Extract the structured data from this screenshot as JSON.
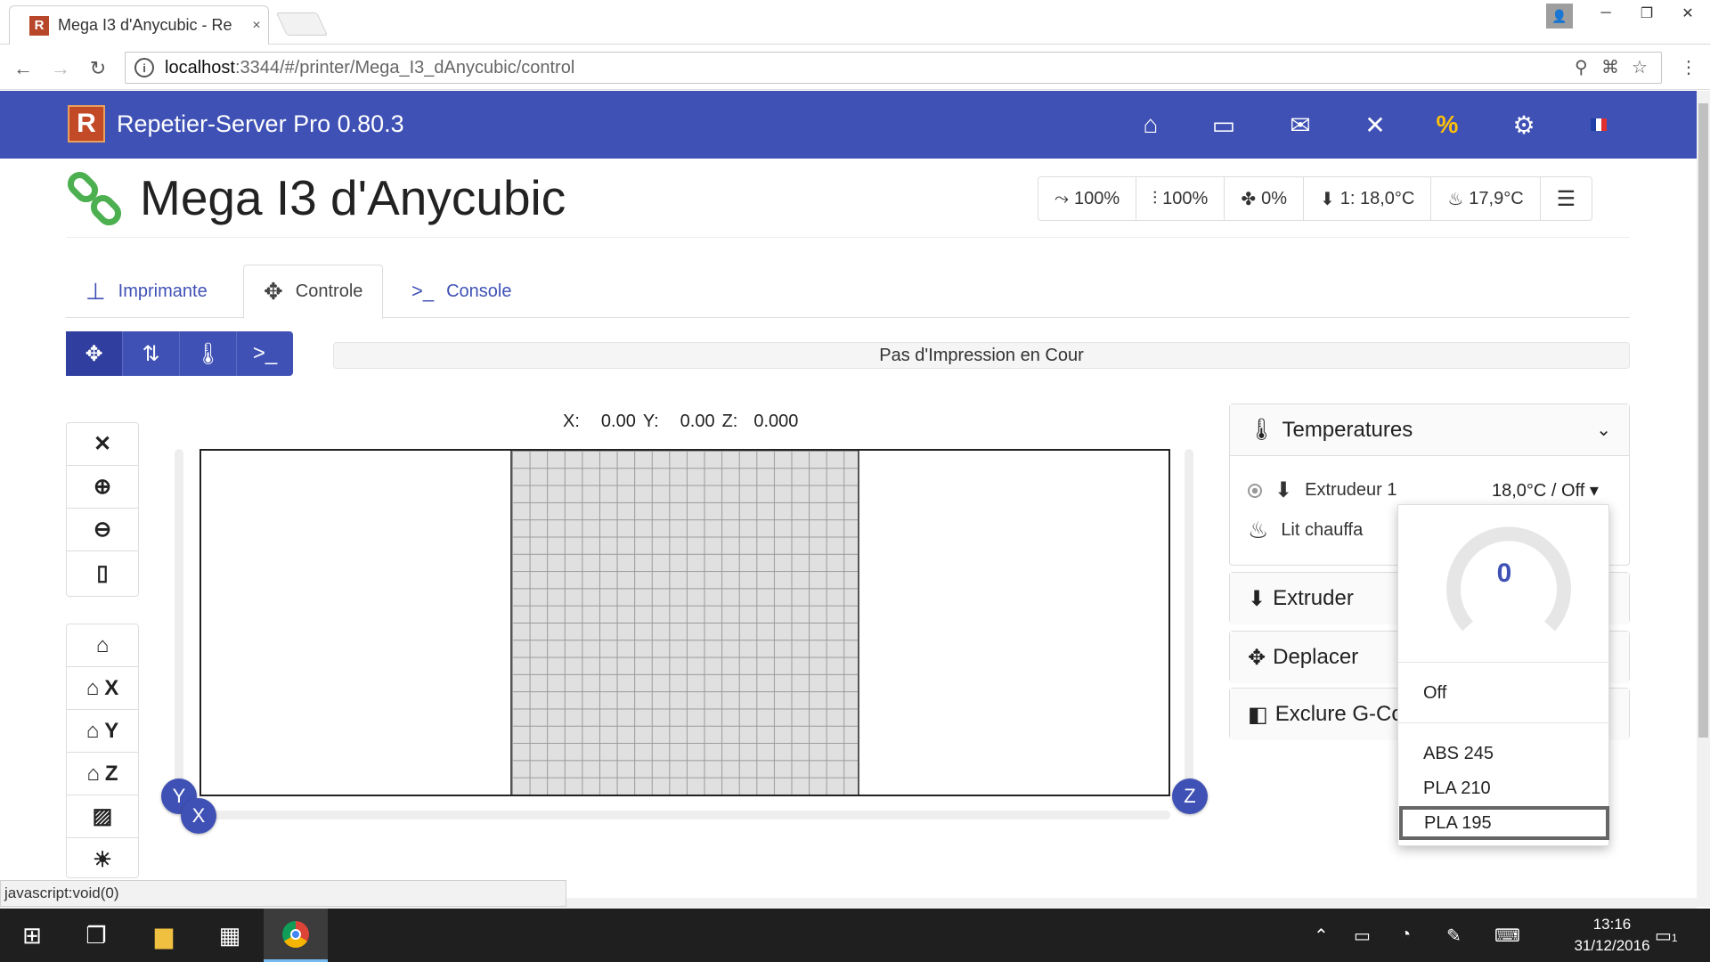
{
  "browser": {
    "tab_title": "Mega I3 d'Anycubic - Re",
    "tab_close": "×",
    "url_host": "localhost",
    "url_path": ":3344/#/printer/Mega_I3_dAnycubic/control",
    "favicon_letter": "R"
  },
  "window": {
    "minimize": "─",
    "maximize": "❐",
    "close": "✕"
  },
  "app": {
    "title": "Repetier-Server Pro 0.80.3",
    "logo_letter": "R",
    "accent": "#3f51b5",
    "highlight": "#ffc107"
  },
  "printer": {
    "name": "Mega I3 d'Anycubic"
  },
  "status": {
    "speed": "100%",
    "flow": "100%",
    "fan": "0%",
    "extruder": "1: 18,0°C",
    "bed": "17,9°C"
  },
  "tabs": [
    {
      "label": "Imprimante",
      "icon": "printer-icon"
    },
    {
      "label": "Controle",
      "icon": "move-icon"
    },
    {
      "label": "Console",
      "icon": "console-icon"
    }
  ],
  "job_status": "Pas d'Impression en Cour",
  "coords": {
    "x_label": "X:",
    "x": "0.00",
    "y_label": "Y:",
    "y": "0.00",
    "z_label": "Z:",
    "z": "0.000"
  },
  "axes": {
    "x": "X",
    "y": "Y",
    "z": "Z"
  },
  "home_buttons": {
    "x": "X",
    "y": "Y",
    "z": "Z"
  },
  "temperatures": {
    "title": "Temperatures",
    "extruder_label": "Extrudeur 1",
    "extruder_value": "18,0°C / Off",
    "bed_label": "Lit chauffa"
  },
  "panels": {
    "extruder": "Extruder",
    "deplacer": "Deplacer",
    "exclure": "Exclure G-Co"
  },
  "dropdown": {
    "gauge_value": "0",
    "off": "Off",
    "presets": [
      "ABS 245",
      "PLA 210",
      "PLA 195"
    ]
  },
  "url_status": "javascript:void(0)",
  "taskbar": {
    "time": "13:16",
    "date": "31/12/2016",
    "notif_count": "1"
  }
}
